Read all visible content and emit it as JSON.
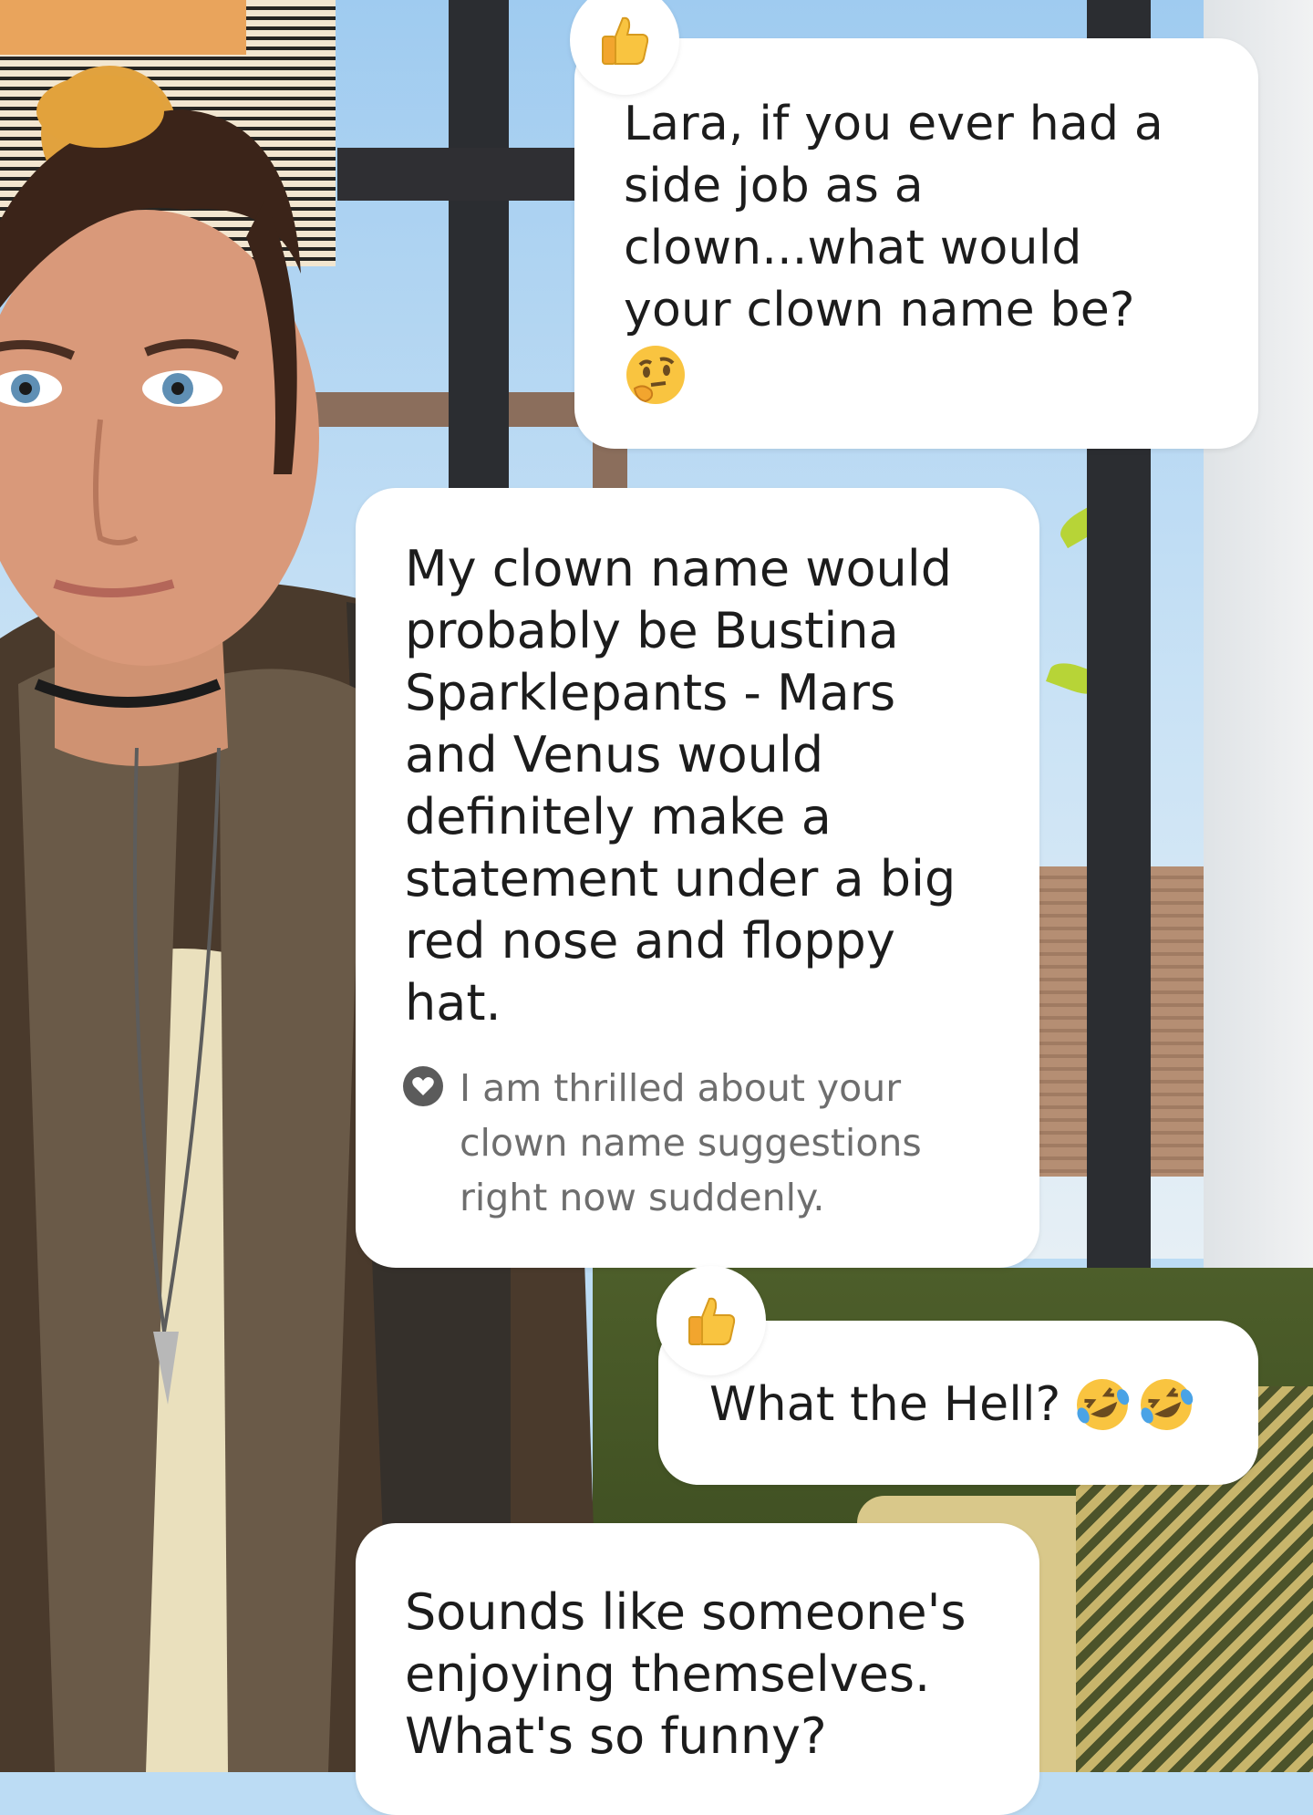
{
  "colors": {
    "bubble": "#ffffff",
    "text": "#1c1c1c",
    "emotion_text": "#6e6e6e",
    "emoji_yellow": "#f9c440"
  },
  "messages": [
    {
      "role": "user",
      "reaction_icon": "thumbs-up",
      "lines": [
        "Lara, if you ever had a",
        "side job as a",
        "clown...what would",
        "your clown name be?"
      ],
      "trailing_emoji": "thinking-face"
    },
    {
      "role": "ai",
      "lines": [
        "My clown name would",
        "probably be Bustina",
        "Sparklepants - Mars",
        "and Venus would",
        "definitely make a",
        "statement under a big",
        "red nose and floppy",
        "hat."
      ],
      "emotion_lines": [
        "I am thrilled about your",
        "clown name suggestions",
        "right now suddenly."
      ]
    },
    {
      "role": "user",
      "reaction_icon": "thumbs-up",
      "text": "What the Hell?",
      "trailing_emojis": [
        "rofl",
        "rofl"
      ]
    },
    {
      "role": "ai",
      "lines": [
        "Sounds like someone's",
        "enjoying themselves.",
        "What's so funny?"
      ]
    }
  ]
}
